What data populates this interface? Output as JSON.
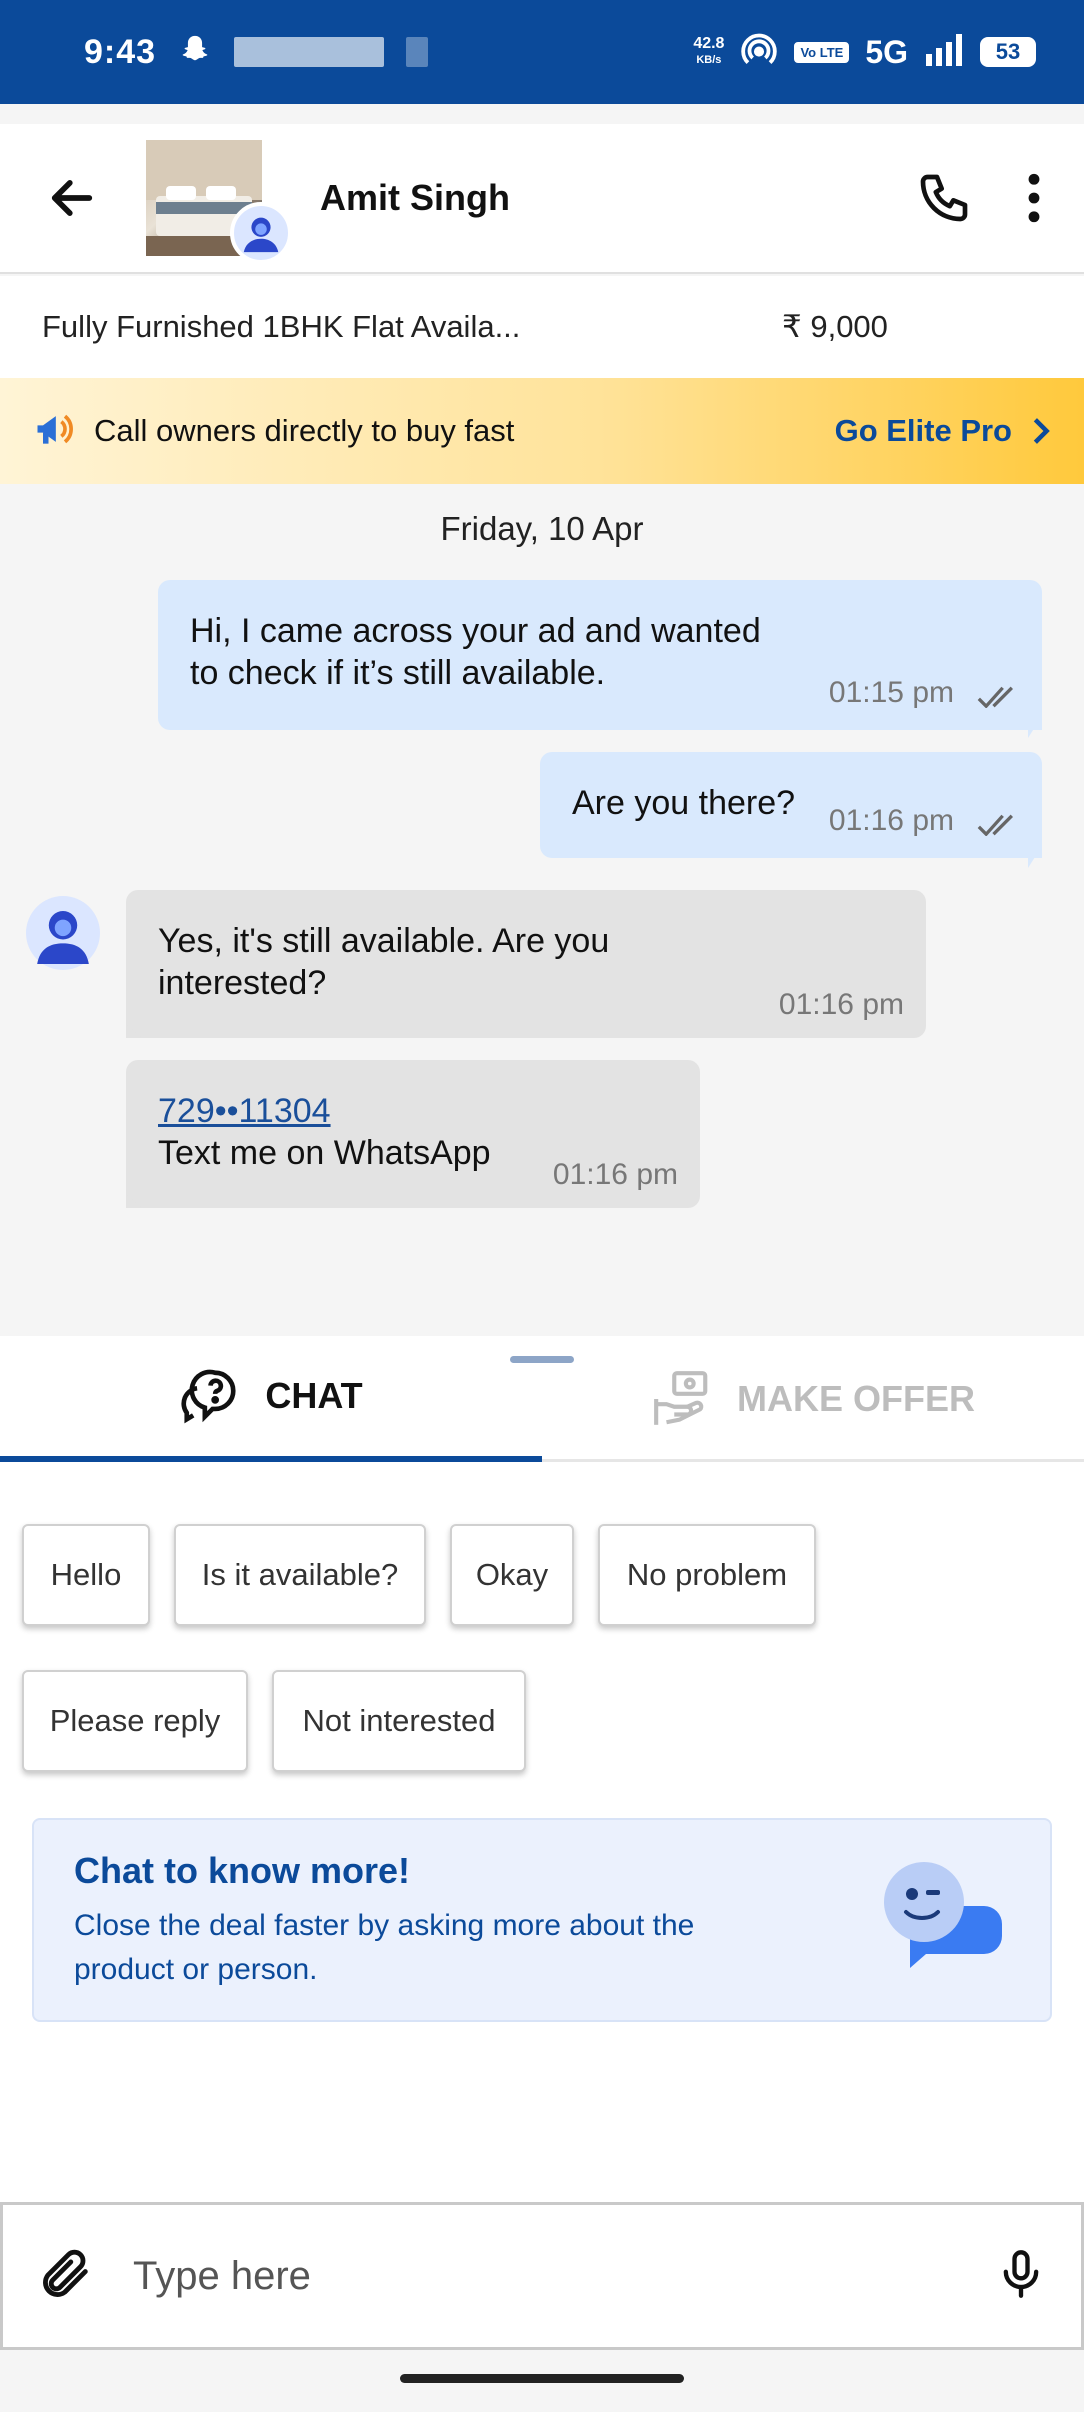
{
  "status": {
    "time": "9:43",
    "netspeed_value": "42.8",
    "netspeed_unit": "KB/s",
    "volte": "Vo LTE",
    "network": "5G",
    "battery": "53"
  },
  "header": {
    "contact_name": "Amit Singh"
  },
  "listing": {
    "title": "Fully Furnished 1BHK Flat Availa...",
    "price": "₹ 9,000"
  },
  "banner": {
    "text": "Call owners directly to buy fast",
    "cta": "Go Elite Pro"
  },
  "chat": {
    "date": "Friday, 10 Apr",
    "messages": [
      {
        "text": "Hi, I came across your ad and wanted to check if it’s still available.",
        "time": "01:15 pm"
      },
      {
        "text": "Are you there?",
        "time": "01:16 pm"
      },
      {
        "text": "Yes, it's still available. Are you interested?",
        "time": "01:16 pm"
      },
      {
        "phone": "729••11304",
        "text": "Text me on WhatsApp",
        "time": "01:16 pm"
      }
    ]
  },
  "tabs": [
    {
      "label": "CHAT"
    },
    {
      "label": "MAKE OFFER"
    }
  ],
  "quick_replies": [
    "Hello",
    "Is it available?",
    "Okay",
    "No problem",
    "Please reply",
    "Not interested"
  ],
  "info": {
    "title": "Chat to know more!",
    "body": "Close the deal faster by asking more about the product or person."
  },
  "input": {
    "placeholder": "Type here"
  },
  "colors": {
    "brand": "#0b4a9a",
    "outgoing_bubble": "#d9e9fd",
    "incoming_bubble": "#e3e3e3",
    "banner_gold": "#ffc93c"
  }
}
